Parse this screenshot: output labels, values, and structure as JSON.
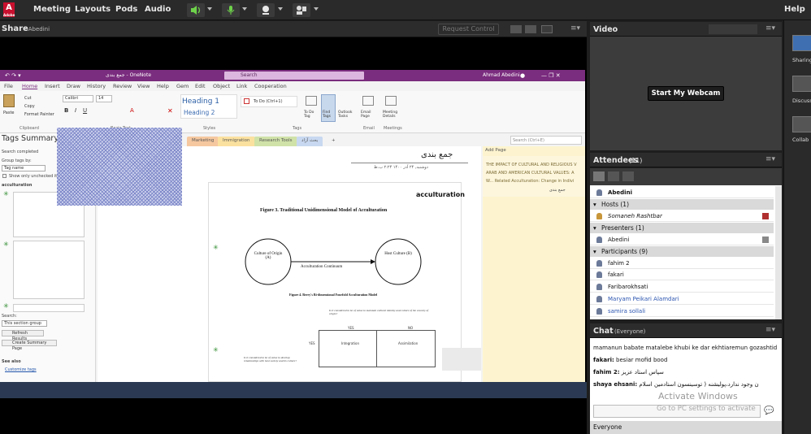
{
  "topbar": {
    "logo_text": "Adobe",
    "menus": [
      "Meeting",
      "Layouts",
      "Pods",
      "Audio"
    ],
    "help": "Help"
  },
  "share_pod": {
    "title": "Share",
    "presenter": "- Abedini",
    "request_control": "Request Control"
  },
  "onenote": {
    "window_title": "جمع بندی - OneNote",
    "search_placeholder": "Search",
    "user": "Ahmad Abedini",
    "menu": [
      "File",
      "Home",
      "Insert",
      "Draw",
      "History",
      "Review",
      "View",
      "Help",
      "Gem",
      "Edit",
      "Object",
      "Link",
      "Cooperation"
    ],
    "ribbon": {
      "paste": "Paste",
      "cut": "Cut",
      "copy": "Copy",
      "format_painter": "Format Painter",
      "clipboard": "Clipboard",
      "font": "Calibri",
      "size": "14",
      "basic_text": "Basic Text",
      "heading1": "Heading 1",
      "heading2": "Heading 2",
      "styles": "Styles",
      "todo": "To Do (Ctrl+1)",
      "tags": "Tags",
      "todo_tag": "To Do Tag",
      "find_tags": "Find Tags",
      "outlook_tasks": "Outlook Tasks",
      "email_page": "Email Page",
      "email": "Email",
      "meeting_details": "Meeting Details",
      "meetings": "Meetings"
    },
    "tags_panel": {
      "title": "Tags Summary",
      "search_completed": "Search completed",
      "group_tags_by": "Group tags by:",
      "group_value": "Tag name",
      "show_unchecked": "Show only unchecked ite",
      "group_heading": "acculturation",
      "search_label": "Search:",
      "search_scope": "This section group",
      "refresh": "Refresh Results",
      "create_summary": "Create Summary Page",
      "see_also": "See also",
      "customize": "Customize tags"
    },
    "section_tabs": [
      "Marketing",
      "Immigration",
      "Research Tools",
      "بحث آزاد",
      "+"
    ],
    "page_search": "Search (Ctrl+E)",
    "page": {
      "title": "جمع بندی",
      "date": "دوشنبه, ۲۴ آذر ۱۴۰۰   ۲:۲۴ ب.ظ",
      "heading": "acculturation",
      "figure3": "Figure 3. Traditional Unidimensional Model of Acculturation",
      "circle_a": "Culture of Origin (A)",
      "circle_b": "Host Culture (B)",
      "continuum": "Acculturation Continuum",
      "figure4": "Figure 4. Berry's Bi-dimensional Fourfold Acculturation Model",
      "q1": "Is it considered to be of value to maintain cultural identity and culture of the country of origin?",
      "yes": "YES",
      "no": "NO",
      "integration": "Integration",
      "assimilation": "Assimilation",
      "q2": "Is it considered to be of value to develop relationships with host society and its culture?"
    },
    "page_list": {
      "add_page": "Add Page",
      "item1": "THE IMPACT OF CULTURAL AND RELIGIOUS V",
      "item2": "ARAB AND AMERICAN CULTURAL VALUES: A",
      "item3": "W... Related Acculturation: Change in Indivi",
      "item4": "جمع بندی"
    }
  },
  "video_pod": {
    "title": "Video",
    "start_webcam": "Start My Webcam"
  },
  "attendees_pod": {
    "title": "Attendees",
    "count": "(11)",
    "me": "Abedini",
    "hosts_label": "Hosts (1)",
    "hosts": [
      "Somaneh Rashtbar"
    ],
    "presenters_label": "Presenters (1)",
    "presenters": [
      "Abedini"
    ],
    "participants_label": "Participants (9)",
    "participants": [
      "fahim 2",
      "fakari",
      "Faribarokhsati",
      "Maryam Peikari Alamdari",
      "samira sollali"
    ]
  },
  "chat_pod": {
    "title": "Chat",
    "scope": "(Everyone)",
    "messages": [
      {
        "who": "",
        "text": "mamanun babate matalebe khubi ke dar ekhtiaremun gozashtid"
      },
      {
        "who": "fakari:",
        "text": "besiar mofid bood"
      },
      {
        "who": "fahim 2:",
        "text": "سپاس استاد عزیز"
      },
      {
        "who": "shaya ehsani:",
        "text": "ن وجود ندارد،پولیشنه ( توسینسون استادمین اسلام"
      }
    ],
    "everyone": "Everyone",
    "watermark_title": "Activate Windows",
    "watermark_sub": "Go to PC settings to activate"
  },
  "side_strip": {
    "items": [
      "Sharing",
      "Discuss",
      "Collab"
    ]
  }
}
